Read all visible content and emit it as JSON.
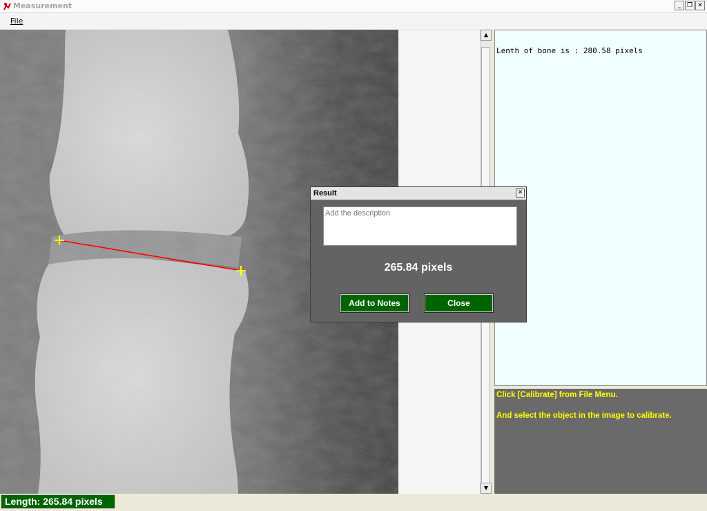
{
  "window": {
    "title": "Measurement"
  },
  "menu": {
    "file": "File"
  },
  "notes": {
    "text": "Lenth of bone is : 280.58 pixels"
  },
  "info": {
    "line1": "Click [Calibrate] from File Menu.",
    "line2": "And select the object in the image to calibrate."
  },
  "status": {
    "length": "Length:  265.84 pixels"
  },
  "dialog": {
    "title": "Result",
    "description_placeholder": "Add the description",
    "value": "265.84 pixels",
    "add_button": "Add to Notes",
    "close_button": "Close"
  },
  "colors": {
    "measure_line": "#ff0000",
    "endpoint_marker": "#ffff00",
    "accent_green": "#006400",
    "info_text": "#ffff00"
  },
  "icons": [
    "app-icon",
    "minimize-icon",
    "restore-icon",
    "close-icon",
    "scroll-up-arrow-icon",
    "scroll-down-arrow-icon",
    "crosshair-marker-icon"
  ]
}
